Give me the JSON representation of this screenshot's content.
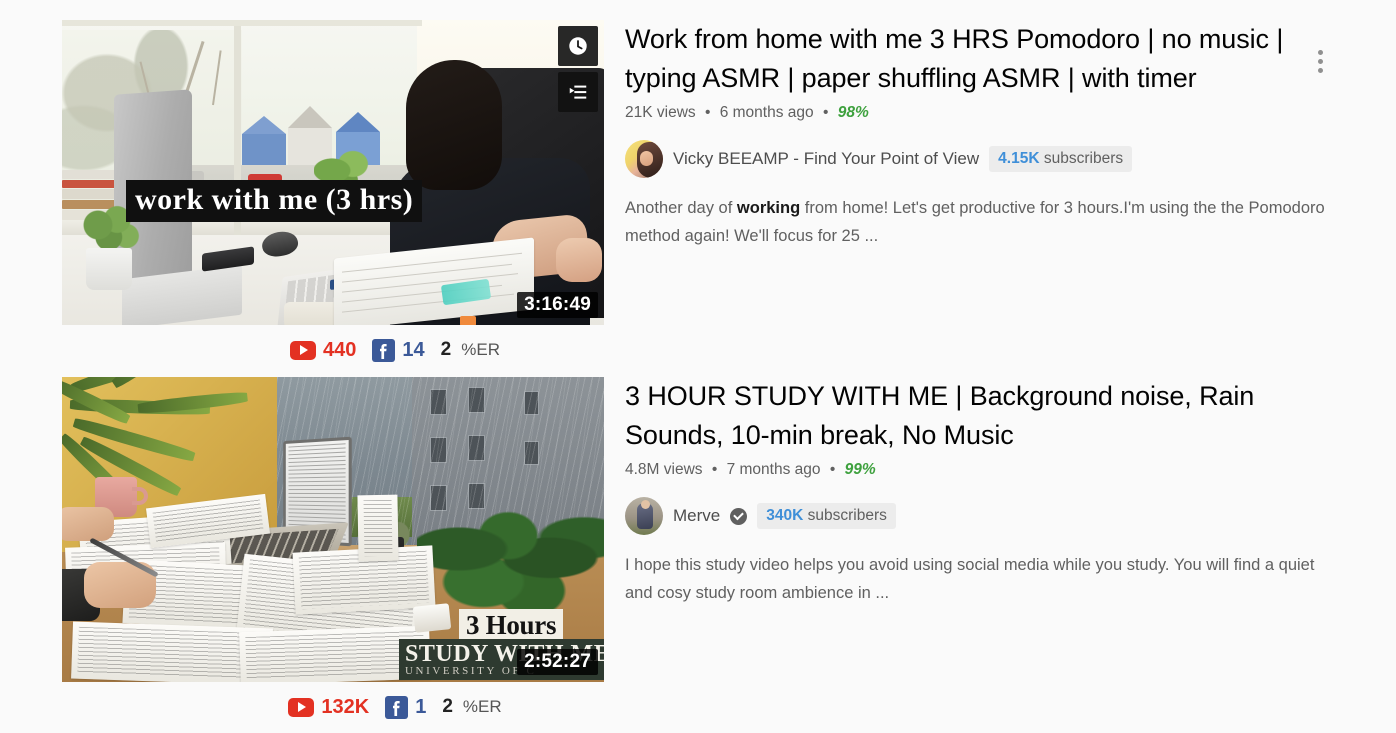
{
  "page": {
    "background_color": "#fafafa"
  },
  "results": [
    {
      "title": "Work from home with me 3 HRS Pomodoro | no music | typing ASMR | paper shuffling ASMR | with timer",
      "views": "21K views",
      "published": "6 months ago",
      "like_ratio": "98%",
      "channel": "Vicky BEEAMP - Find Your Point of View",
      "verified": false,
      "subscribers_count": "4.15K",
      "subscribers_label": "subscribers",
      "description_pre": "Another day of ",
      "description_bold": "working",
      "description_post": " from home! Let's get productive for 3 hours.I'm using the the Pomodoro method again! We'll focus for 25 ...",
      "duration": "3:16:49",
      "thumbnail_caption": "work with me (3 hrs)",
      "stats": {
        "youtube_icon": "youtube-play-icon",
        "youtube_count": "440",
        "facebook_icon": "facebook-icon",
        "facebook_count": "14",
        "er_value": "2",
        "er_label": "%ER"
      },
      "overlay_actions": [
        {
          "icon": "clock-icon",
          "name": "watch-later-button"
        },
        {
          "icon": "queue-icon",
          "name": "add-to-queue-button"
        }
      ]
    },
    {
      "title": "3 HOUR STUDY WITH ME | Background noise, Rain Sounds, 10-min break, No Music",
      "views": "4.8M views",
      "published": "7 months ago",
      "like_ratio": "99%",
      "channel": "Merve",
      "verified": true,
      "subscribers_count": "340K",
      "subscribers_label": "subscribers",
      "description_pre": "I hope this study video helps you avoid using social media while you study. You will find a quiet and cosy study room ambience in ...",
      "description_bold": "",
      "description_post": "",
      "duration": "2:52:27",
      "thumbnail_caption_1": "3 Hours",
      "thumbnail_caption_2": "STUDY WITH ME",
      "thumbnail_caption_3": "UNIVERSITY OF C",
      "stats": {
        "youtube_icon": "youtube-play-icon",
        "youtube_count": "132K",
        "facebook_icon": "facebook-icon",
        "facebook_count": "1",
        "er_value": "2",
        "er_label": "%ER"
      }
    }
  ],
  "menu": {
    "icon": "kebab-menu-icon"
  },
  "colors": {
    "youtube_red": "#e33122",
    "facebook_blue": "#3b5998",
    "ratio_green": "#3ea13e",
    "subscriber_blue": "#3f8fd8"
  }
}
